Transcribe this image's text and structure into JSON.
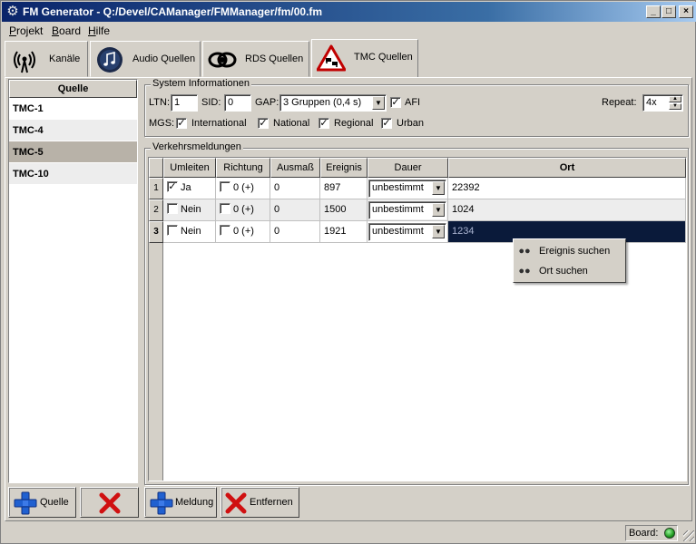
{
  "window": {
    "title": "FM Generator - Q:/Devel/CAManager/FMManager/fm/00.fm",
    "controls": {
      "minimize": "_",
      "maximize": "□",
      "close": "×"
    }
  },
  "menu": {
    "items": [
      {
        "label": "Projekt",
        "accel": "P",
        "rest": "rojekt"
      },
      {
        "label": "Board",
        "accel": "B",
        "rest": "oard"
      },
      {
        "label": "Hilfe",
        "accel": "H",
        "rest": "ilfe"
      }
    ]
  },
  "tabs": [
    {
      "label": "Kanäle",
      "icon": "antenna-icon"
    },
    {
      "label": "Audio Quellen",
      "icon": "music-icon"
    },
    {
      "label": "RDS Quellen",
      "icon": "rds-icon"
    },
    {
      "label": "TMC Quellen",
      "icon": "traffic-warning-icon",
      "active": true
    }
  ],
  "sources": {
    "header": "Quelle",
    "items": [
      "TMC-1",
      "TMC-4",
      "TMC-5",
      "TMC-10"
    ],
    "selected": "TMC-5"
  },
  "system": {
    "legend": "System Informationen",
    "ltn_label": "LTN:",
    "ltn_value": "1",
    "sid_label": "SID:",
    "sid_value": "0",
    "gap_label": "GAP:",
    "gap_value": "3 Gruppen (0,4 s)",
    "afi_label": "AFI",
    "afi_checked": true,
    "repeat_label": "Repeat:",
    "repeat_value": "4x",
    "mgs_label": "MGS:",
    "mgs": [
      {
        "label": "International",
        "checked": true
      },
      {
        "label": "National",
        "checked": true
      },
      {
        "label": "Regional",
        "checked": true
      },
      {
        "label": "Urban",
        "checked": true
      }
    ]
  },
  "messages": {
    "legend": "Verkehrsmeldungen",
    "columns": [
      "Umleiten",
      "Richtung",
      "Ausmaß",
      "Ereignis",
      "Dauer",
      "Ort"
    ],
    "rows": [
      {
        "num": "1",
        "umleiten": "Ja",
        "umleiten_checked": true,
        "richtung": "0 (+)",
        "ausmass": "0",
        "ereignis": "897",
        "dauer": "unbestimmt",
        "ort": "22392"
      },
      {
        "num": "2",
        "umleiten": "Nein",
        "umleiten_checked": false,
        "richtung": "0 (+)",
        "ausmass": "0",
        "ereignis": "1500",
        "dauer": "unbestimmt",
        "ort": "1024"
      },
      {
        "num": "3",
        "umleiten": "Nein",
        "umleiten_checked": false,
        "richtung": "0 (+)",
        "ausmass": "0",
        "ereignis": "1921",
        "dauer": "unbestimmt",
        "ort": "1234"
      }
    ]
  },
  "context_menu": {
    "items": [
      {
        "label": "Ereignis suchen",
        "icon": "binoculars-icon"
      },
      {
        "label": "Ort suchen",
        "icon": "binoculars-icon"
      }
    ]
  },
  "buttons": {
    "add_source": "Quelle",
    "delete_source": "",
    "add_message": "Meldung",
    "remove_message": "Entfernen"
  },
  "status": {
    "board_label": "Board:",
    "board_led_color": "#1f9a1f"
  },
  "colors": {
    "titlebar": "#0a246a",
    "selection": "#0a1a3a",
    "face": "#d4d0c8"
  }
}
